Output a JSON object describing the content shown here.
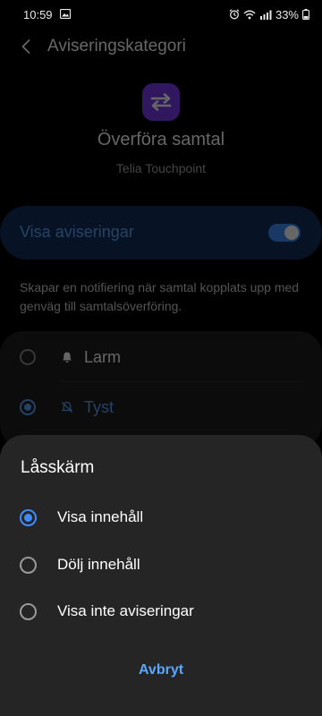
{
  "status_bar": {
    "time": "10:59",
    "battery": "33%"
  },
  "header": {
    "title": "Aviseringskategori"
  },
  "app": {
    "name": "Överföra samtal",
    "subtitle": "Telia Touchpoint",
    "icon": "swap-arrows-icon",
    "icon_color": "#7c3aed"
  },
  "toggle_card": {
    "label": "Visa aviseringar",
    "enabled": true
  },
  "description": "Skapar en notifiering när samtal kopplats upp med genväg till samtalsöverföring.",
  "importance": {
    "options": [
      {
        "label": "Larm",
        "icon": "bell-icon",
        "selected": false
      },
      {
        "label": "Tyst",
        "icon": "bell-off-icon",
        "selected": true
      }
    ]
  },
  "dialog": {
    "title": "Låsskärm",
    "options": [
      {
        "label": "Visa innehåll",
        "selected": true
      },
      {
        "label": "Dölj innehåll",
        "selected": false
      },
      {
        "label": "Visa inte aviseringar",
        "selected": false
      }
    ],
    "cancel_label": "Avbryt"
  },
  "colors": {
    "accent": "#3d8bff",
    "sheet_background": "#252525"
  }
}
